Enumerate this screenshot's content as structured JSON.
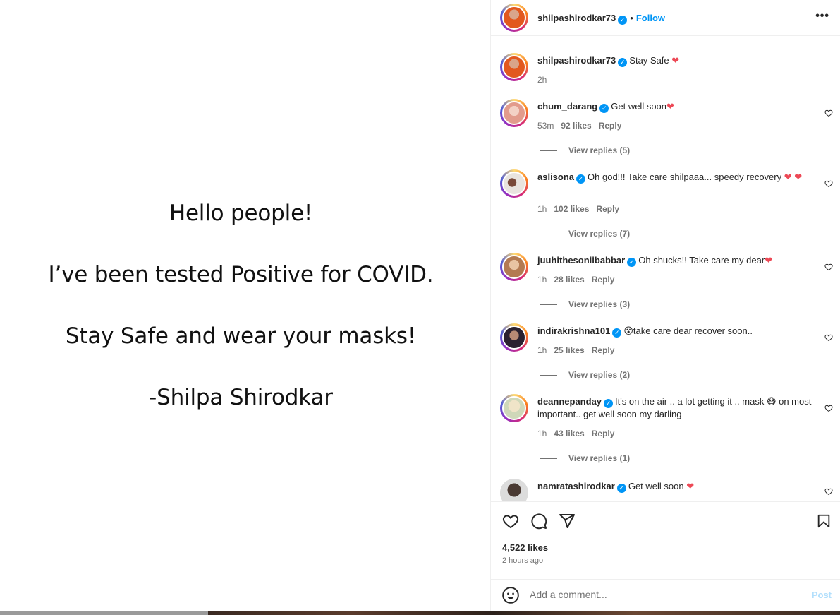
{
  "post": {
    "lines": [
      "Hello people!",
      "I’ve been tested Positive for COVID.",
      "Stay Safe and wear your masks!",
      "-Shilpa Shirodkar"
    ]
  },
  "header": {
    "username": "shilpashirodkar73",
    "verified": "✓",
    "separator": "•",
    "follow_label": "Follow",
    "more_label": "•••"
  },
  "caption": {
    "username": "shilpashirodkar73",
    "text": "Stay Safe ❤",
    "time": "2h"
  },
  "comments": [
    {
      "username": "chum_darang",
      "text": "Get well soon❤",
      "time": "53m",
      "likes": "92 likes",
      "reply": "Reply",
      "view_replies": "View replies (5)"
    },
    {
      "username": "aslisona",
      "text": "Oh god!!! Take care shilpaaa... speedy recovery ❤ ❤",
      "time": "1h",
      "likes": "102 likes",
      "reply": "Reply",
      "view_replies": "View replies (7)"
    },
    {
      "username": "juuhithesoniibabbar",
      "text": "Oh shucks!! Take care my dear❤",
      "time": "1h",
      "likes": "28 likes",
      "reply": "Reply",
      "view_replies": "View replies (3)"
    },
    {
      "username": "indirakrishna101",
      "text": "😮take care dear recover soon..",
      "time": "1h",
      "likes": "25 likes",
      "reply": "Reply",
      "view_replies": "View replies (2)"
    },
    {
      "username": "deannepanday",
      "text": "It's on the air .. a lot getting it .. mask 😷 on most important.. get well soon my darling",
      "time": "1h",
      "likes": "43 likes",
      "reply": "Reply",
      "view_replies": "View replies (1)"
    },
    {
      "username": "namratashirodkar",
      "text": "Get well soon ❤",
      "time": "",
      "likes": "",
      "reply": "",
      "view_replies": ""
    }
  ],
  "footer": {
    "likes": "4,522 likes",
    "time": "2 hours ago",
    "comment_placeholder": "Add a comment...",
    "post_label": "Post"
  },
  "colors": {
    "accent": "#0095f6",
    "heart": "#ed4956",
    "post_disabled": "#b2dffc"
  }
}
